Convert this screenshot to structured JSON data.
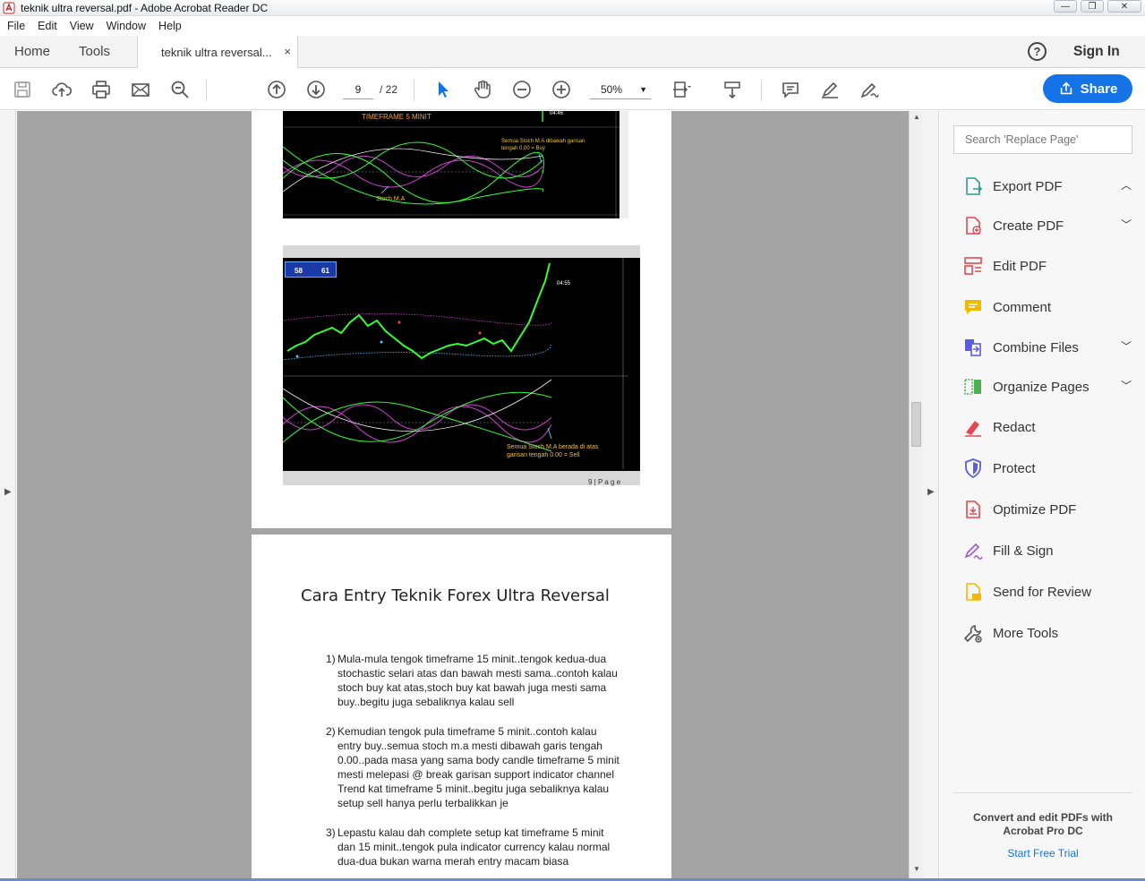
{
  "window": {
    "title": "teknik ultra reversal.pdf - Adobe Acrobat Reader DC",
    "minimize": "—",
    "restore": "❐",
    "close": "✕"
  },
  "menu": [
    "File",
    "Edit",
    "View",
    "Window",
    "Help"
  ],
  "tabs": {
    "home": "Home",
    "tools": "Tools",
    "doc": "teknik ultra reversal...",
    "close": "×"
  },
  "header": {
    "help": "?",
    "signin": "Sign In"
  },
  "toolbar": {
    "page_current": "9",
    "page_total": "/ 22",
    "zoom": "50%",
    "share": "Share"
  },
  "document": {
    "chart1": {
      "timeframe_label": "TIMEFRAME 5 MINIT",
      "price_label": "04:46",
      "annotation": "Semua Stoch M.A dibawah garisan tengah 0.00 = Buy",
      "indicator_label": "Stoch M.A"
    },
    "chart2": {
      "bid_price": "58",
      "ask_price": "61",
      "price_label": "04:55",
      "annotation": "Semua Stoch M.A berada di atas garisan tengah 0.00 = Sell"
    },
    "page_number": "9 | P a g e",
    "page2_title": "Cara Entry Teknik Forex Ultra Reversal",
    "paragraphs": [
      {
        "num": "1)",
        "text": "Mula-mula tengok timeframe 15 minit..tengok kedua-dua stochastic selari  atas dan bawah mesti sama..contoh kalau stoch buy kat atas,stoch buy kat bawah juga mesti sama buy..begitu juga sebaliknya kalau sell"
      },
      {
        "num": "2)",
        "text": " Kemudian tengok pula timeframe 5 minit..contoh kalau entry buy..semua stoch m.a mesti dibawah garis tengah 0.00..pada masa yang sama body candle timeframe 5 minit mesti melepasi @ break garisan support indicator channel Trend kat timeframe 5 minit..begitu juga sebaliknya kalau setup sell hanya perlu terbalikkan je"
      },
      {
        "num": "3)",
        "text": " Lepastu kalau dah complete setup kat timeframe 5 minit dan 15 minit..tengok pula indicator currency kalau normal dua-dua bukan warna merah entry macam biasa"
      }
    ]
  },
  "right_panel": {
    "search_placeholder": "Search 'Replace Page'",
    "tools": [
      {
        "label": "Export PDF",
        "chevron": "up",
        "color": "#2d9c8c"
      },
      {
        "label": "Create PDF",
        "chevron": "down",
        "color": "#e34850"
      },
      {
        "label": "Edit PDF",
        "chevron": "",
        "color": "#e34850"
      },
      {
        "label": "Comment",
        "chevron": "",
        "color": "#f5b800"
      },
      {
        "label": "Combine Files",
        "chevron": "down",
        "color": "#5c5ce0"
      },
      {
        "label": "Organize Pages",
        "chevron": "down",
        "color": "#4caf50"
      },
      {
        "label": "Redact",
        "chevron": "",
        "color": "#e34850"
      },
      {
        "label": "Protect",
        "chevron": "",
        "color": "#5c5ce0"
      },
      {
        "label": "Optimize PDF",
        "chevron": "",
        "color": "#e34850"
      },
      {
        "label": "Fill & Sign",
        "chevron": "",
        "color": "#9b59d0"
      },
      {
        "label": "Send for Review",
        "chevron": "",
        "color": "#f5b800"
      },
      {
        "label": "More Tools",
        "chevron": "",
        "color": "#555555"
      }
    ],
    "promo": "Convert and edit PDFs with Acrobat Pro DC",
    "trial": "Start Free Trial"
  },
  "colors": {
    "accent": "#1473e6",
    "doc_bg": "#a4a4a4"
  }
}
